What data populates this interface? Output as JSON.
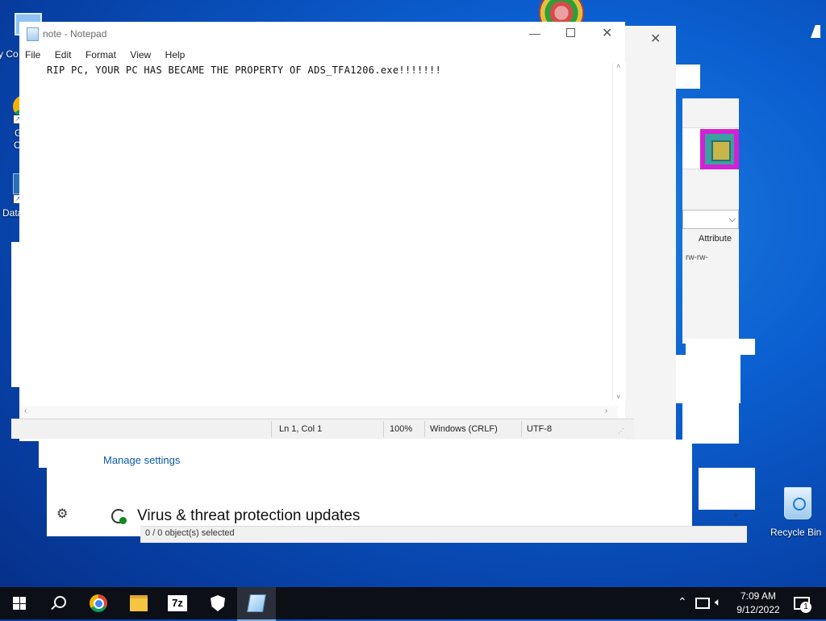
{
  "desktop": {
    "icons": [
      {
        "name": "my-computer",
        "label": "My Computer"
      },
      {
        "name": "google-chrome",
        "label": "Google Chrome"
      },
      {
        "name": "datawrapper",
        "label": "DataWrapper"
      }
    ],
    "visible_labels": {
      "mycomputer": "y Co",
      "chrome1": "Go",
      "chrome2": "Ch",
      "data": "DataW"
    },
    "recycle_bin": "Recycle Bin"
  },
  "notepad": {
    "title": "note - Notepad",
    "menu": [
      "File",
      "Edit",
      "Format",
      "View",
      "Help"
    ],
    "content": "RIP PC, YOUR PC HAS BECAME THE PROPERTY OF ADS_TFA1206.exe!!!!!!!",
    "status": {
      "position": "Ln 1, Col 1",
      "zoom": "100%",
      "line_ending": "Windows (CRLF)",
      "encoding": "UTF-8"
    }
  },
  "background_window": {
    "attribute_col": "Attribute",
    "attr_value": "rw-rw-",
    "status_text": "0 / 0 object(s) selected"
  },
  "security": {
    "manage_settings": "Manage settings",
    "section_title": "Virus & threat protection updates"
  },
  "taskbar": {
    "pinned": [
      "start",
      "search",
      "chrome",
      "file-explorer",
      "7-zip",
      "windows-security",
      "notepad"
    ],
    "sevenzip_label": "7z",
    "time": "7:09 AM",
    "date": "9/12/2022",
    "notification_count": "1"
  }
}
